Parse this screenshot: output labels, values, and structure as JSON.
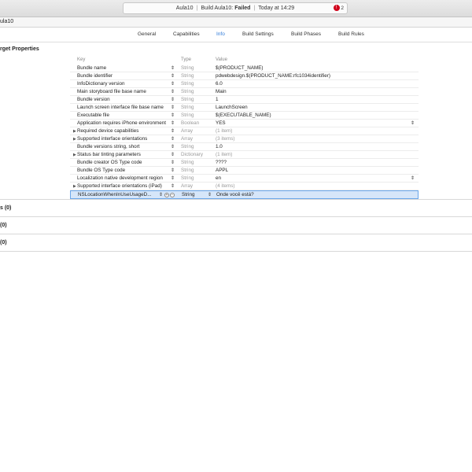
{
  "activity": {
    "project": "Aula10",
    "build_prefix": "Build Aula10:",
    "build_status": "Failed",
    "time": "Today at 14:29",
    "error_count": "2"
  },
  "pathbar": {
    "label": "ula10"
  },
  "tabs": [
    "General",
    "Capabilities",
    "Info",
    "Build Settings",
    "Build Phases",
    "Build Rules"
  ],
  "active_tab": "Info",
  "section_title": "rget Properties",
  "headers": {
    "key": "Key",
    "type": "Type",
    "value": "Value"
  },
  "rows": [
    {
      "key": "Bundle name",
      "type": "String",
      "value": "$(PRODUCT_NAME)"
    },
    {
      "key": "Bundle identifier",
      "type": "String",
      "value": "pdwebdesign.$(PRODUCT_NAME:rfc1034identifier)"
    },
    {
      "key": "InfoDictionary version",
      "type": "String",
      "value": "6.0"
    },
    {
      "key": "Main storyboard file base name",
      "type": "String",
      "value": "Main"
    },
    {
      "key": "Bundle version",
      "type": "String",
      "value": "1"
    },
    {
      "key": "Launch screen interface file base name",
      "type": "String",
      "value": "LaunchScreen"
    },
    {
      "key": "Executable file",
      "type": "String",
      "value": "$(EXECUTABLE_NAME)"
    },
    {
      "key": "Application requires iPhone environment",
      "type": "Boolean",
      "value": "YES"
    },
    {
      "key": "Required device capabilities",
      "type": "Array",
      "value": "(1 item)"
    },
    {
      "key": "Supported interface orientations",
      "type": "Array",
      "value": "(3 items)"
    },
    {
      "key": "Bundle versions string, short",
      "type": "String",
      "value": "1.0"
    },
    {
      "key": "Status bar tinting parameters",
      "type": "Dictionary",
      "value": "(1 item)"
    },
    {
      "key": "Bundle creator OS Type code",
      "type": "String",
      "value": "????"
    },
    {
      "key": "Bundle OS Type code",
      "type": "String",
      "value": "APPL"
    },
    {
      "key": "Localization native development region",
      "type": "String",
      "value": "en"
    },
    {
      "key": "Supported interface orientations (iPad)",
      "type": "Array",
      "value": "(4 items)"
    },
    {
      "key": "NSLocationWhenInUseUsageD...",
      "type": "String",
      "value": "Onde você está?"
    }
  ],
  "groups": [
    "s (0)",
    "(0)",
    "(0)"
  ],
  "icons": {
    "stepper": "up-down-arrows-icon",
    "disclosure": "disclosure-triangle-icon",
    "add": "plus-circle-icon",
    "remove": "minus-circle-icon",
    "error": "error-circle-icon"
  },
  "colors": {
    "accent": "#2f7bd9",
    "error": "#d0021b",
    "selection": "#d6e6f9"
  }
}
